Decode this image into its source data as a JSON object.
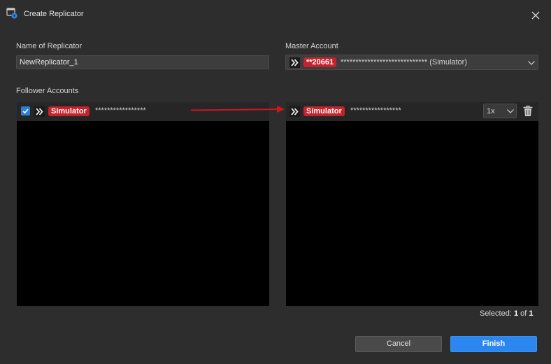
{
  "dialog": {
    "title": "Create Replicator",
    "title_icon": "replicator-icon",
    "close_icon": "close-icon"
  },
  "name_field": {
    "label": "Name of Replicator",
    "value": "NewReplicator_1"
  },
  "master": {
    "label": "Master Account",
    "badge": "**20661",
    "masked": "*****************************",
    "suffix": "(Simulator)"
  },
  "followers": {
    "label": "Follower Accounts",
    "left_item": {
      "checked": true,
      "badge": "Simulator",
      "masked": "*****************"
    },
    "right_item": {
      "badge": "Simulator",
      "masked": "*****************",
      "multiplier": "1x"
    }
  },
  "selection": {
    "prefix": "Selected:",
    "count": "1",
    "of": "of",
    "total": "1"
  },
  "buttons": {
    "cancel": "Cancel",
    "finish": "Finish"
  },
  "colors": {
    "accent": "#2b86f0",
    "badge": "#c4232c",
    "arrow": "#d0161d",
    "background": "#2d2d2d"
  }
}
